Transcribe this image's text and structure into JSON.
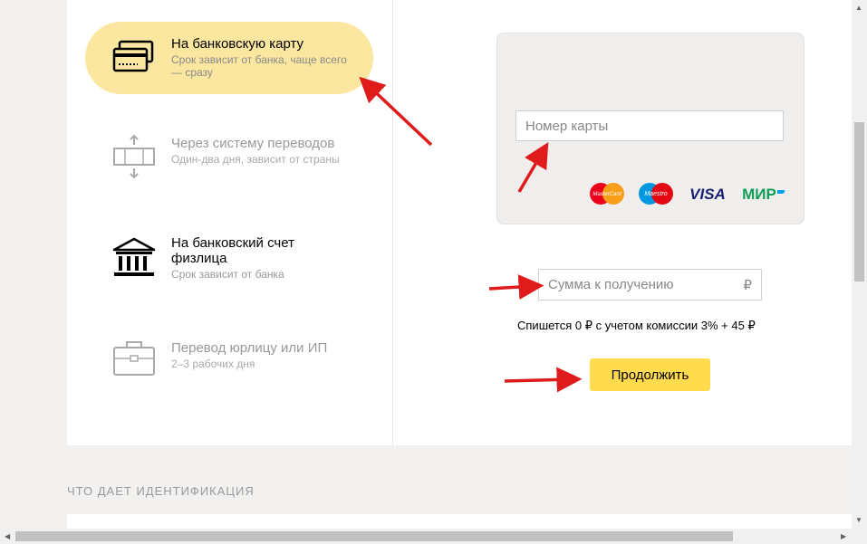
{
  "methods": [
    {
      "title": "На банковскую карту",
      "subtitle": "Срок зависит от банка, чаще всего — сразу",
      "icon": "bank-card-icon",
      "active": true
    },
    {
      "title": "Через систему переводов",
      "subtitle": "Один-два дня, зависит от страны",
      "icon": "transfer-system-icon",
      "active": false
    },
    {
      "title": "На банковский счет физлица",
      "subtitle": "Срок зависит от банка",
      "icon": "bank-building-icon",
      "active": false
    },
    {
      "title": "Перевод юрлицу или ИП",
      "subtitle": "2–3 рабочих дня",
      "icon": "briefcase-icon",
      "active": false
    }
  ],
  "card_form": {
    "card_placeholder": "Номер карты",
    "brands": [
      "MasterCard",
      "Maestro",
      "VISA",
      "МИР"
    ]
  },
  "amount": {
    "placeholder": "Сумма к получению",
    "currency": "₽"
  },
  "fee_text": "Спишется 0  ₽ с учетом комиссии 3% + 45 ₽",
  "continue_label": "Продолжить",
  "section_title": "Что дает идентификация",
  "colors": {
    "active_bg": "#fbe7a0",
    "button": "#ffdb4d",
    "annotation_arrow": "#e01b1b"
  }
}
